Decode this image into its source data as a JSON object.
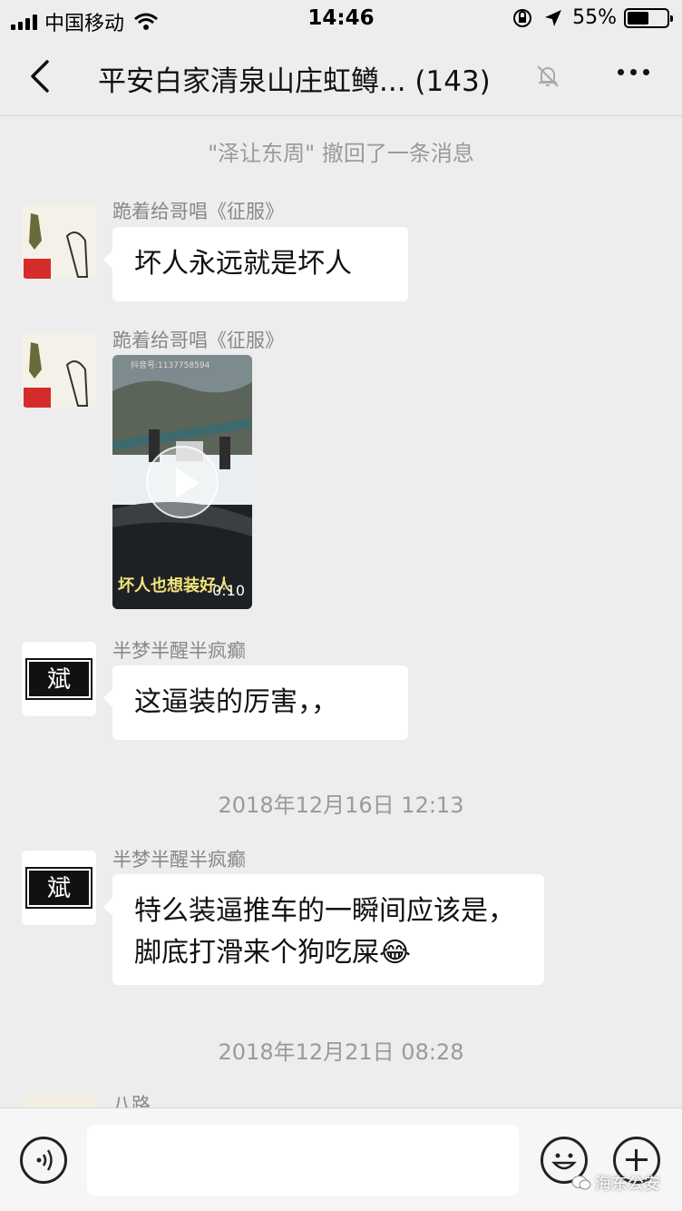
{
  "status_bar": {
    "carrier": "中国移动",
    "time": "14:46",
    "battery": "55%",
    "battery_level": 0.55,
    "icons": [
      "signal-icon",
      "wifi-icon",
      "orientation-lock-icon",
      "location-icon",
      "battery-icon"
    ]
  },
  "nav": {
    "title": "平安白家清泉山庄虹鳟... (143)",
    "back_icon": "chevron-left-icon",
    "mute_icon": "bell-slash-icon",
    "more_icon": "more-dots-icon"
  },
  "chat": {
    "recall_notice": "\"泽让东周\" 撤回了一条消息",
    "messages": [
      {
        "sender": "跪着给哥唱《征服》",
        "text": "坏人永远就是坏人"
      },
      {
        "sender": "跪着给哥唱《征服》",
        "video_caption": "坏人也想装好人",
        "video_duration": "0:10",
        "video_watermark": "抖音号:1137758594"
      },
      {
        "sender": "半梦半醒半疯癫",
        "text": "这逼装的厉害，，",
        "avatar_glyph": "斌"
      },
      {
        "sender": "半梦半醒半疯癫",
        "text": "特么装逼推车的一瞬间应该是，脚底打滑来个狗吃屎😂",
        "avatar_glyph": "斌"
      },
      {
        "sender": "八路"
      }
    ],
    "timestamps": [
      "2018年12月16日 12:13",
      "2018年12月21日 08:28"
    ]
  },
  "input_bar": {
    "voice_icon": "voice-icon",
    "emoji_icon": "emoji-icon",
    "plus_icon": "plus-icon"
  },
  "brand_watermark": "海东公安",
  "colors": {
    "background": "#ededed",
    "bubble": "#ffffff",
    "secondary_text": "#9a9a9a"
  }
}
